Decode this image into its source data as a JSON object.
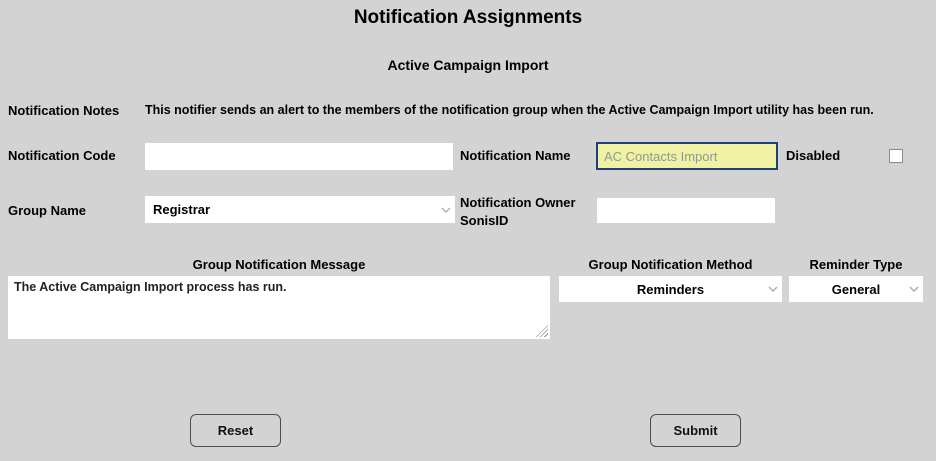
{
  "page": {
    "title": "Notification Assignments",
    "subtitle": "Active Campaign Import"
  },
  "notes": {
    "label": "Notification Notes",
    "text": "This notifier sends an alert to the members of the notification group when the Active Campaign Import utility has been run."
  },
  "form": {
    "notification_code": {
      "label": "Notification Code",
      "value": ""
    },
    "notification_name": {
      "label": "Notification Name",
      "value": "",
      "placeholder": "AC Contacts Import"
    },
    "disabled": {
      "label": "Disabled",
      "checked": false
    },
    "group_name": {
      "label": "Group Name",
      "selected": "Registrar"
    },
    "notification_owner": {
      "label": "Notification Owner SonisID",
      "value": ""
    },
    "message": {
      "header": "Group Notification Message",
      "value": "The Active Campaign Import process has run."
    },
    "method": {
      "header": "Group Notification Method",
      "selected": "Reminders"
    },
    "reminder_type": {
      "header": "Reminder Type",
      "selected": "General"
    }
  },
  "buttons": {
    "reset": "Reset",
    "submit": "Submit"
  },
  "colors": {
    "background": "#d3d3d3",
    "highlight_field": "#f1f1a3",
    "focus_border": "#1f3f7d"
  }
}
